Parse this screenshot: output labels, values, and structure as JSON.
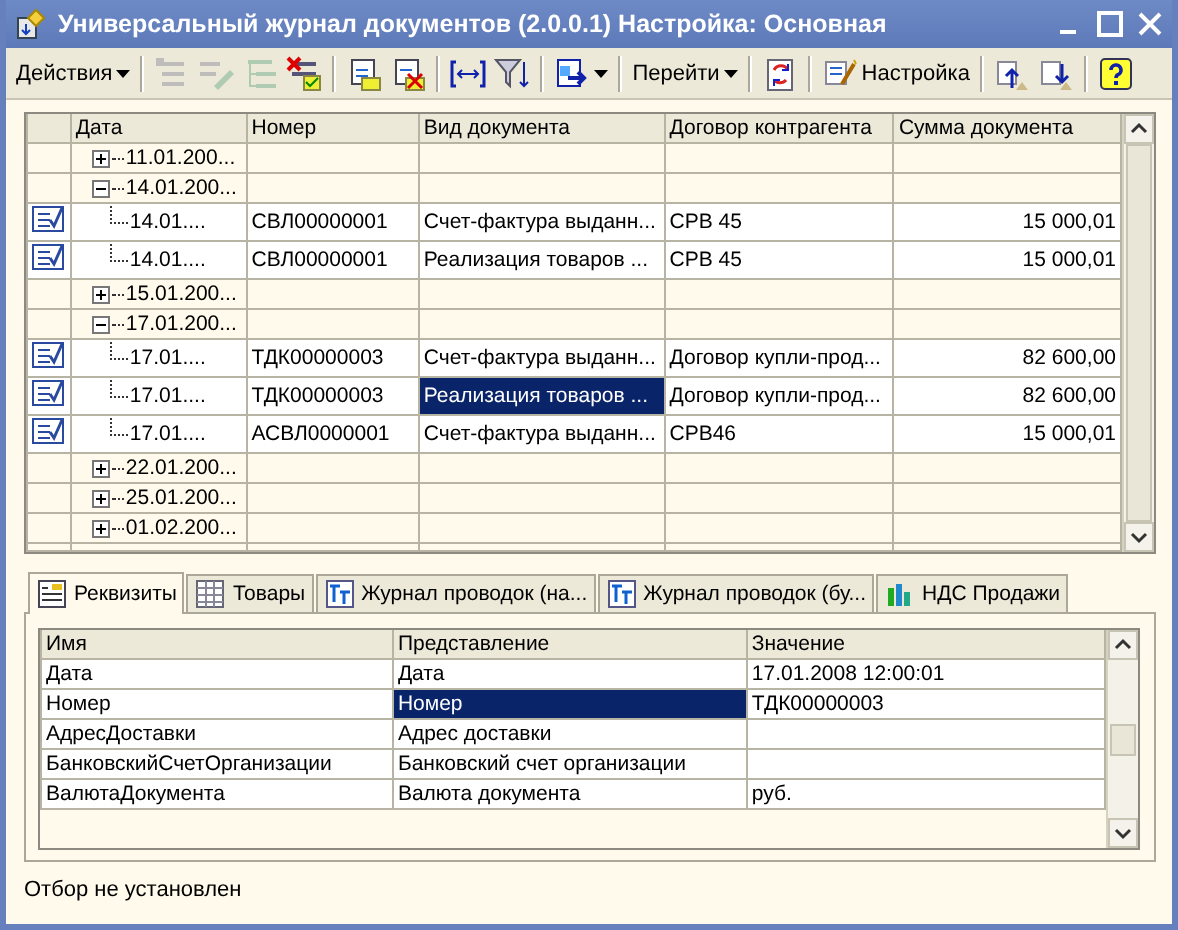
{
  "window": {
    "title": "Универсальный журнал документов (2.0.0.1) Настройка: Основная"
  },
  "toolbar": [
    {
      "kind": "menu",
      "label": "Действия",
      "disabled": false
    },
    {
      "kind": "separator"
    },
    {
      "kind": "icon",
      "disabled": true
    },
    {
      "kind": "icon",
      "disabled": true
    },
    {
      "kind": "icon",
      "disabled": true
    },
    {
      "kind": "icon",
      "disabled": false
    },
    {
      "kind": "separator"
    },
    {
      "kind": "icon",
      "disabled": false
    },
    {
      "kind": "icon",
      "disabled": false
    },
    {
      "kind": "separator"
    },
    {
      "kind": "icon",
      "disabled": false
    },
    {
      "kind": "icon",
      "disabled": false
    },
    {
      "kind": "separator"
    },
    {
      "kind": "dropicon",
      "disabled": false
    },
    {
      "kind": "separator"
    },
    {
      "kind": "menu",
      "label": "Перейти",
      "disabled": false
    },
    {
      "kind": "separator"
    },
    {
      "kind": "icon",
      "disabled": false
    },
    {
      "kind": "separator"
    },
    {
      "kind": "button",
      "label": "Настройка",
      "disabled": false
    },
    {
      "kind": "separator"
    },
    {
      "kind": "icon",
      "disabled": false
    },
    {
      "kind": "icon",
      "disabled": false
    },
    {
      "kind": "separator"
    },
    {
      "kind": "icon",
      "disabled": false
    }
  ],
  "table": {
    "columns": [
      "Дата",
      "Номер",
      "Вид документа",
      "Договор контрагента",
      "Сумма документа"
    ],
    "rows": [
      {
        "date": "11.01.200...",
        "expanded": false,
        "children": []
      },
      {
        "date": "14.01.200...",
        "expanded": true,
        "children": [
          {
            "date": "14.01....",
            "number": "СВЛ00000001",
            "type": "Счет-фактура выданн...",
            "contract": "СРВ 45",
            "sum": "15 000,01",
            "selected": false
          },
          {
            "date": "14.01....",
            "number": "СВЛ00000001",
            "type": "Реализация товаров ...",
            "contract": "СРВ 45",
            "sum": "15 000,01",
            "selected": false
          }
        ]
      },
      {
        "date": "15.01.200...",
        "expanded": false,
        "children": []
      },
      {
        "date": "17.01.200...",
        "expanded": true,
        "children": [
          {
            "date": "17.01....",
            "number": "ТДК00000003",
            "type": "Счет-фактура выданн...",
            "contract": "Договор купли-прод...",
            "sum": "82 600,00",
            "selected": false
          },
          {
            "date": "17.01....",
            "number": "ТДК00000003",
            "type": "Реализация товаров ...",
            "contract": "Договор купли-прод...",
            "sum": "82 600,00",
            "selected": true
          },
          {
            "date": "17.01....",
            "number": "АСВЛ0000001",
            "type": "Счет-фактура выданн...",
            "contract": "СРВ46",
            "sum": "15 000,01",
            "selected": false
          }
        ]
      },
      {
        "date": "22.01.200...",
        "expanded": false,
        "children": []
      },
      {
        "date": "25.01.200...",
        "expanded": false,
        "children": []
      },
      {
        "date": "01.02.200...",
        "expanded": false,
        "children": []
      }
    ]
  },
  "tabs": [
    {
      "label": "Реквизиты",
      "selected": true
    },
    {
      "label": "Товары",
      "selected": false
    },
    {
      "label": "Журнал проводок (на...",
      "selected": false
    },
    {
      "label": "Журнал проводок (бу...",
      "selected": false
    },
    {
      "label": "НДС Продажи",
      "selected": false
    }
  ],
  "details": {
    "columns": [
      "Имя",
      "Представление",
      "Значение"
    ],
    "rows": [
      {
        "name": "Дата",
        "presentation": "Дата",
        "value": "17.01.2008 12:00:01",
        "selected": false
      },
      {
        "name": "Номер",
        "presentation": "Номер",
        "value": "ТДК00000003",
        "selected": true
      },
      {
        "name": "АдресДоставки",
        "presentation": "Адрес доставки",
        "value": "",
        "selected": false
      },
      {
        "name": "БанковскийСчетОрганизации",
        "presentation": "Банковский счет организации",
        "value": "",
        "selected": false
      },
      {
        "name": "ВалютаДокумента",
        "presentation": "Валюта документа",
        "value": "руб.",
        "selected": false
      }
    ]
  },
  "status_bar": "Отбор не установлен"
}
